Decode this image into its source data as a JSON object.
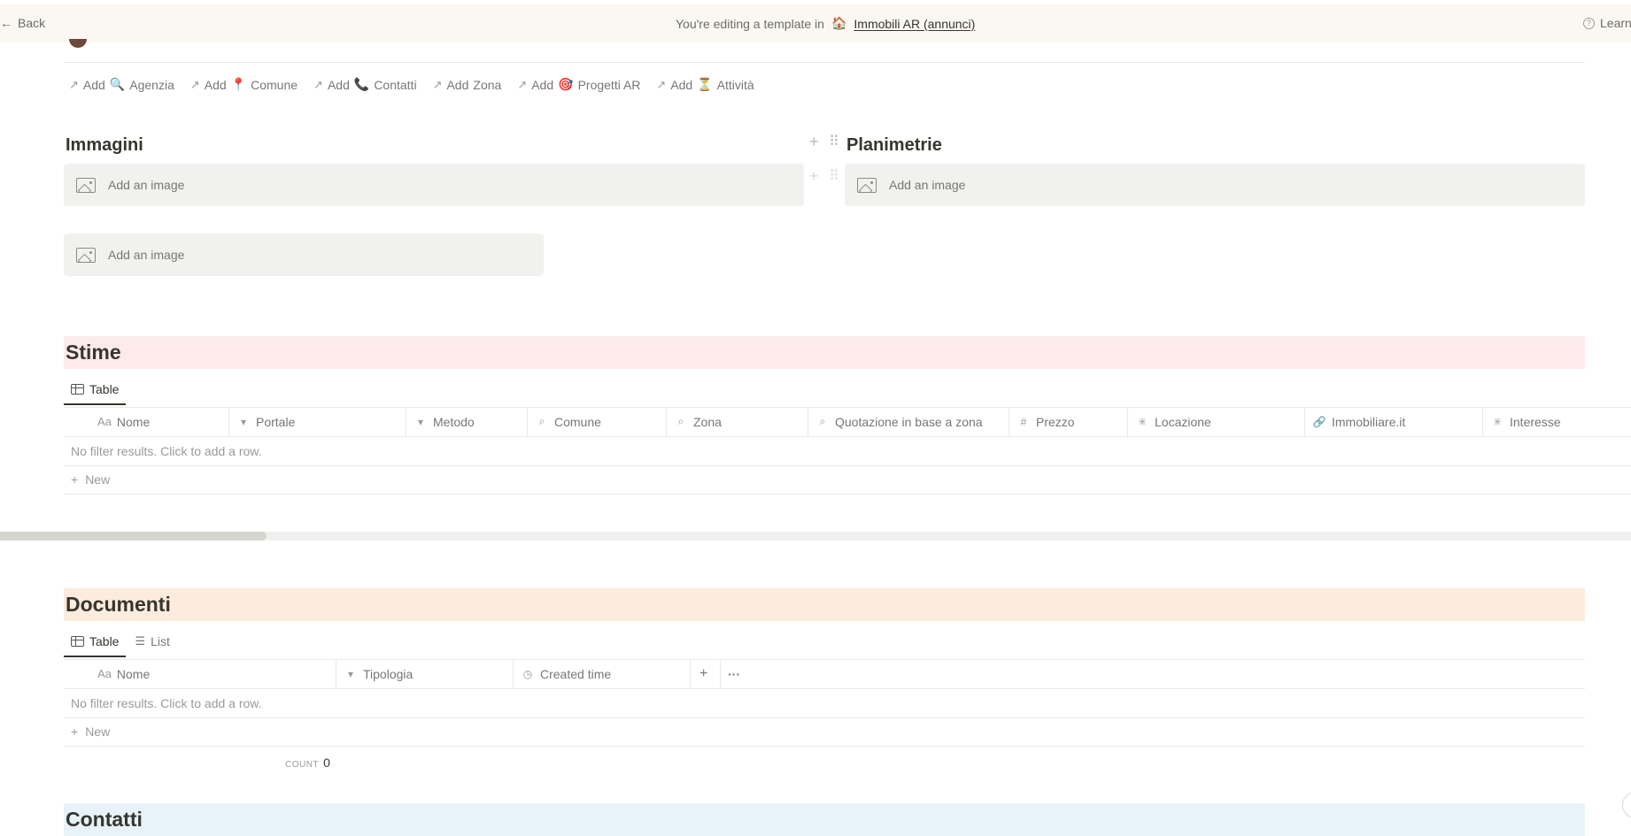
{
  "banner": {
    "back_label": "Back",
    "editing_text": "You're editing a template in",
    "workspace_emoji": "🏠",
    "workspace_name": "Immobili AR (annunci)",
    "learn_label": "Learn"
  },
  "relations": [
    {
      "label": "Add",
      "emoji": "🔍",
      "name": "Agenzia"
    },
    {
      "label": "Add",
      "emoji": "📍",
      "name": "Comune"
    },
    {
      "label": "Add",
      "emoji": "📞",
      "name": "Contatti"
    },
    {
      "label": "Add",
      "emoji": "",
      "name": "Zona"
    },
    {
      "label": "Add",
      "emoji": "🎯",
      "name": "Progetti AR"
    },
    {
      "label": "Add",
      "emoji": "⏳",
      "name": "Attività"
    }
  ],
  "images": {
    "left_title": "Immagini",
    "right_title": "Planimetrie",
    "placeholder": "Add an image"
  },
  "stime": {
    "title": "Stime",
    "color": "#fdebec",
    "tabs": [
      {
        "label": "Table",
        "icon": "table-icon"
      }
    ],
    "columns": [
      {
        "icon": "Aa",
        "label": "Nome"
      },
      {
        "icon": "▾",
        "label": "Portale"
      },
      {
        "icon": "▾",
        "label": "Metodo"
      },
      {
        "icon": "⌕",
        "label": "Comune"
      },
      {
        "icon": "⌕",
        "label": "Zona"
      },
      {
        "icon": "⌕",
        "label": "Quotazione in base a zona"
      },
      {
        "icon": "#",
        "label": "Prezzo"
      },
      {
        "icon": "✳",
        "label": "Locazione"
      },
      {
        "icon": "🔗",
        "label": "Immobiliare.it"
      },
      {
        "icon": "✳",
        "label": "Interesse"
      }
    ],
    "empty_text": "No filter results. Click to add a row.",
    "new_label": "New"
  },
  "documenti": {
    "title": "Documenti",
    "color": "#fbecdd",
    "tabs": [
      {
        "label": "Table",
        "icon": "table-icon"
      },
      {
        "label": "List",
        "icon": "list-icon"
      }
    ],
    "columns": [
      {
        "icon": "Aa",
        "label": "Nome"
      },
      {
        "icon": "▾",
        "label": "Tipologia"
      },
      {
        "icon": "◷",
        "label": "Created time"
      }
    ],
    "add_column": "+",
    "more": "···",
    "empty_text": "No filter results. Click to add a row.",
    "new_label": "New",
    "count_label": "COUNT",
    "count_value": "0"
  },
  "contatti": {
    "title": "Contatti",
    "color": "#e7f3f8"
  }
}
